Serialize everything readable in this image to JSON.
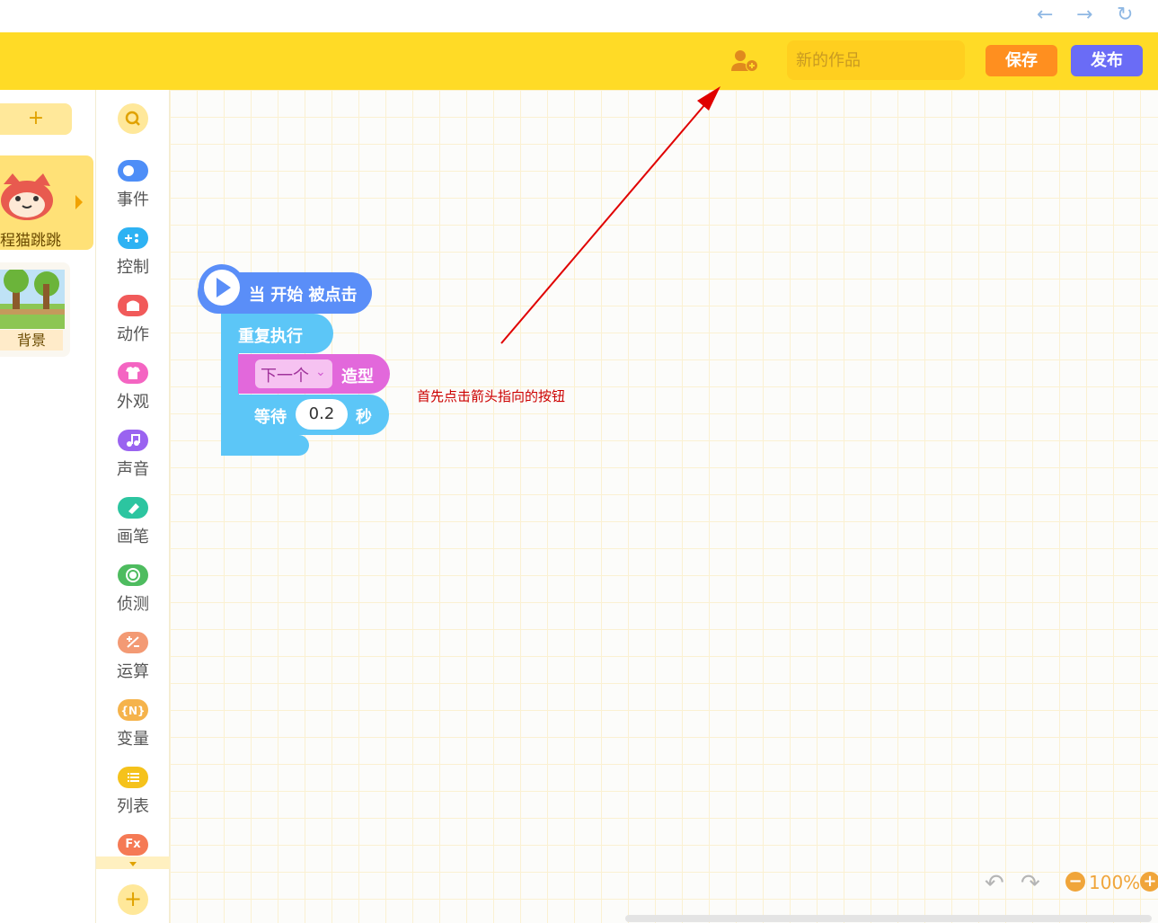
{
  "browser": {
    "back_icon": "left-arrow-icon",
    "forward_icon": "right-arrow-icon",
    "refresh_icon": "refresh-icon"
  },
  "header": {
    "title_placeholder": "新的作品",
    "save_label": "保存",
    "publish_label": "发布",
    "colors": {
      "bar": "#ffdb26",
      "save": "#ff8f1f",
      "publish": "#6a6cf6"
    }
  },
  "sprites": {
    "add_label": "+",
    "items": [
      {
        "name": "程猫跳跳"
      }
    ],
    "background_label": "背景"
  },
  "categories": [
    {
      "label": "事件",
      "color": "#4e8ef7",
      "icon": "toggle-icon"
    },
    {
      "label": "控制",
      "color": "#2eb2f3",
      "icon": "gamepad-icon"
    },
    {
      "label": "动作",
      "color": "#f15a5a",
      "icon": "ghost-icon"
    },
    {
      "label": "外观",
      "color": "#f465c2",
      "icon": "shirt-icon"
    },
    {
      "label": "声音",
      "color": "#9a63f0",
      "icon": "music-icon"
    },
    {
      "label": "画笔",
      "color": "#2cc5a0",
      "icon": "eraser-icon"
    },
    {
      "label": "侦测",
      "color": "#4ebc5f",
      "icon": "target-icon"
    },
    {
      "label": "运算",
      "color": "#f39a74",
      "icon": "plus-minus-icon"
    },
    {
      "label": "变量",
      "color": "#f5b34b",
      "icon": "variable-icon"
    },
    {
      "label": "列表",
      "color": "#f5c21b",
      "icon": "list-icon"
    }
  ],
  "extra_category_icon": "Fx",
  "blocks": {
    "hat_label": "当 开始 被点击",
    "repeat_label": "重复执行",
    "costume_dropdown": "下一个",
    "costume_label": "造型",
    "wait_label": "等待",
    "wait_value": "0.2",
    "wait_unit": "秒"
  },
  "annotation": "首先点击箭头指向的按钮",
  "zoom": {
    "value": "100%"
  }
}
